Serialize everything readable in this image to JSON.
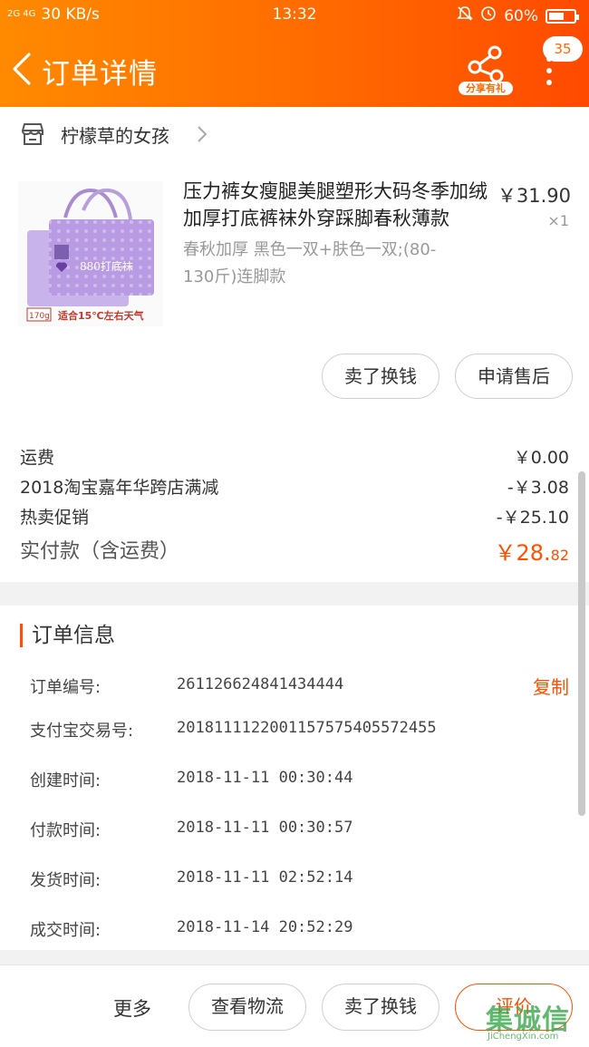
{
  "status_bar": {
    "signal_label": "2G 4G",
    "network_speed": "30 KB/s",
    "time": "13:32",
    "battery": "60%",
    "battery_level": 0.6
  },
  "header": {
    "title": "订单详情",
    "share_label": "分享有礼",
    "message_count": "35"
  },
  "shop": {
    "name": "柠檬草的女孩"
  },
  "product": {
    "title": "压力裤女瘦腿美腿塑形大码冬季加绒加厚打底裤袜外穿踩脚春秋薄款",
    "price": "￥31.90",
    "quantity": "×1",
    "sku": "春秋加厚 黑色一双+肤色一双;(80-130斤)连脚款",
    "image_text": {
      "brand": "880打底袜",
      "weight": "170g",
      "caption": "适合15℃左右天气"
    },
    "actions": {
      "sell": "卖了换钱",
      "after_sale": "申请售后"
    }
  },
  "fees": [
    {
      "label": "运费",
      "value": "￥0.00"
    },
    {
      "label": "2018淘宝嘉年华跨店满减",
      "value": "-￥3.08"
    },
    {
      "label": "热卖促销",
      "value": "-￥25.10"
    }
  ],
  "total": {
    "label": "实付款（含运费）",
    "value_main": "￥28.",
    "value_cents": "82"
  },
  "order_info": {
    "title": "订单信息",
    "copy_label": "复制",
    "rows": [
      {
        "label": "订单编号:",
        "value": "261126624841434444"
      },
      {
        "label": "支付宝交易号:",
        "value": "2018111122001157575405572455"
      },
      {
        "label": "创建时间:",
        "value": "2018-11-11 00:30:44"
      },
      {
        "label": "付款时间:",
        "value": "2018-11-11 00:30:57"
      },
      {
        "label": "发货时间:",
        "value": "2018-11-11 02:52:14"
      },
      {
        "label": "成交时间:",
        "value": "2018-11-14 20:52:29"
      }
    ]
  },
  "bottom_bar": {
    "more": "更多",
    "logistics": "查看物流",
    "sell": "卖了换钱",
    "review": "评价"
  },
  "watermark": {
    "text": "集诚信",
    "url": "JiChengXin.com"
  },
  "colors": {
    "accent": "#ff5000",
    "header_start": "#ff8a00",
    "header_end": "#ff4a00"
  }
}
